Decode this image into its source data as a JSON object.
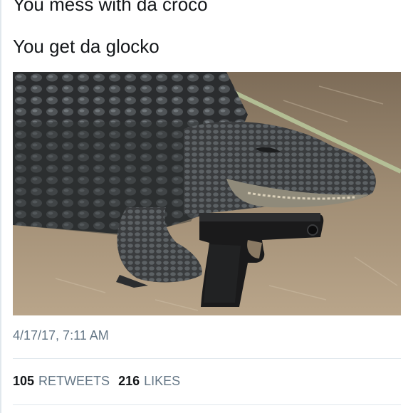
{
  "tweet": {
    "lines": [
      "You mess with da croco",
      "You get da glocko"
    ],
    "timestamp": "4/17/17, 7:11 AM",
    "media": {
      "alt": "Alligator resting on dirt with a black handgun edited in front of it"
    }
  },
  "stats": {
    "retweets": {
      "count": "105",
      "label": "RETWEETS"
    },
    "likes": {
      "count": "216",
      "label": "LIKES"
    }
  },
  "colors": {
    "text": "#14171a",
    "muted": "#657786",
    "divider": "#e1e8ed"
  }
}
